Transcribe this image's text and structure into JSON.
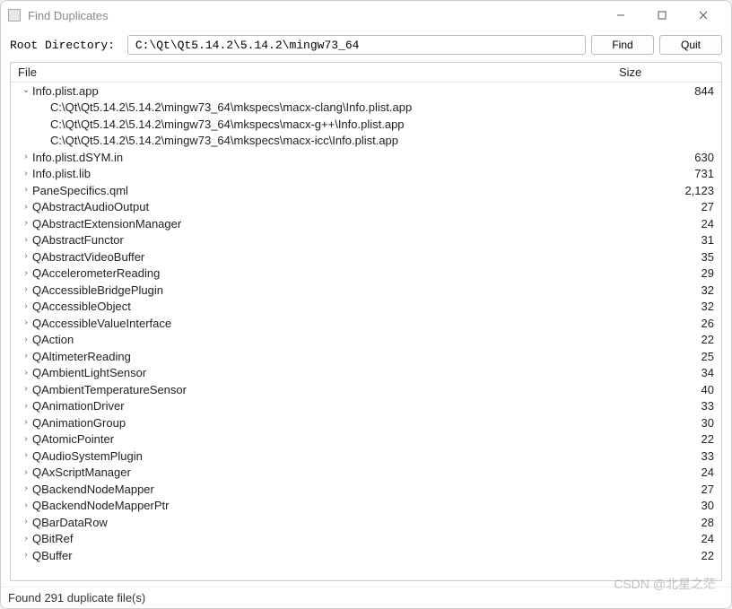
{
  "window": {
    "title": "Find Duplicates"
  },
  "toolbar": {
    "label": "Root Directory: ",
    "path": "C:\\Qt\\Qt5.14.2\\5.14.2\\mingw73_64",
    "find": "Find",
    "quit": "Quit"
  },
  "columns": {
    "file": "File",
    "size": "Size"
  },
  "tree": [
    {
      "name": "Info.plist.app",
      "size": "844",
      "expanded": true,
      "children": [
        "C:\\Qt\\Qt5.14.2\\5.14.2\\mingw73_64\\mkspecs\\macx-clang\\Info.plist.app",
        "C:\\Qt\\Qt5.14.2\\5.14.2\\mingw73_64\\mkspecs\\macx-g++\\Info.plist.app",
        "C:\\Qt\\Qt5.14.2\\5.14.2\\mingw73_64\\mkspecs\\macx-icc\\Info.plist.app"
      ]
    },
    {
      "name": "Info.plist.dSYM.in",
      "size": "630",
      "expanded": false
    },
    {
      "name": "Info.plist.lib",
      "size": "731",
      "expanded": false
    },
    {
      "name": "PaneSpecifics.qml",
      "size": "2,123",
      "expanded": false
    },
    {
      "name": "QAbstractAudioOutput",
      "size": "27",
      "expanded": false
    },
    {
      "name": "QAbstractExtensionManager",
      "size": "24",
      "expanded": false
    },
    {
      "name": "QAbstractFunctor",
      "size": "31",
      "expanded": false
    },
    {
      "name": "QAbstractVideoBuffer",
      "size": "35",
      "expanded": false
    },
    {
      "name": "QAccelerometerReading",
      "size": "29",
      "expanded": false
    },
    {
      "name": "QAccessibleBridgePlugin",
      "size": "32",
      "expanded": false
    },
    {
      "name": "QAccessibleObject",
      "size": "32",
      "expanded": false
    },
    {
      "name": "QAccessibleValueInterface",
      "size": "26",
      "expanded": false
    },
    {
      "name": "QAction",
      "size": "22",
      "expanded": false
    },
    {
      "name": "QAltimeterReading",
      "size": "25",
      "expanded": false
    },
    {
      "name": "QAmbientLightSensor",
      "size": "34",
      "expanded": false
    },
    {
      "name": "QAmbientTemperatureSensor",
      "size": "40",
      "expanded": false
    },
    {
      "name": "QAnimationDriver",
      "size": "33",
      "expanded": false
    },
    {
      "name": "QAnimationGroup",
      "size": "30",
      "expanded": false
    },
    {
      "name": "QAtomicPointer",
      "size": "22",
      "expanded": false
    },
    {
      "name": "QAudioSystemPlugin",
      "size": "33",
      "expanded": false
    },
    {
      "name": "QAxScriptManager",
      "size": "24",
      "expanded": false
    },
    {
      "name": "QBackendNodeMapper",
      "size": "27",
      "expanded": false
    },
    {
      "name": "QBackendNodeMapperPtr",
      "size": "30",
      "expanded": false
    },
    {
      "name": "QBarDataRow",
      "size": "28",
      "expanded": false
    },
    {
      "name": "QBitRef",
      "size": "24",
      "expanded": false
    },
    {
      "name": "QBuffer",
      "size": "22",
      "expanded": false
    }
  ],
  "status": "Found 291 duplicate file(s)",
  "watermark": "CSDN @北星之茫"
}
